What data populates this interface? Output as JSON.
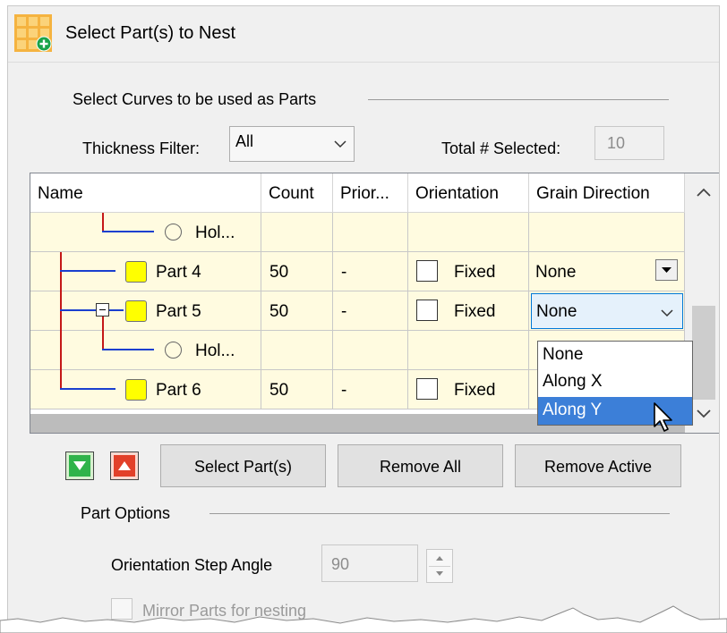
{
  "title": "Select Part(s) to Nest",
  "app_icon": "nest-grid-add-icon",
  "curves_section": {
    "label": "Select Curves to be used as Parts",
    "thickness_label": "Thickness Filter:",
    "thickness_value": "All",
    "total_label": "Total # Selected:",
    "total_value": "10"
  },
  "table": {
    "columns": [
      "Name",
      "Count",
      "Prior...",
      "Orientation",
      "Grain Direction"
    ],
    "rows": [
      {
        "name": "Hol...",
        "kind": "hole",
        "count": "",
        "priority": "",
        "orientation": "",
        "grain": ""
      },
      {
        "name": "Part 4",
        "kind": "part",
        "count": "50",
        "priority": "-",
        "orientation": "Fixed",
        "grain": "None"
      },
      {
        "name": "Part 5",
        "kind": "part",
        "count": "50",
        "priority": "-",
        "orientation": "Fixed",
        "grain": "None"
      },
      {
        "name": "Hol...",
        "kind": "hole",
        "count": "",
        "priority": "",
        "orientation": "",
        "grain": ""
      },
      {
        "name": "Part 6",
        "kind": "part",
        "count": "50",
        "priority": "-",
        "orientation": "Fixed",
        "grain": ""
      }
    ]
  },
  "grain_dropdown": {
    "options": [
      "None",
      "Along X",
      "Along Y"
    ],
    "highlighted": "Along Y",
    "highlight_color": "#3c7fd8"
  },
  "buttons": {
    "move_down_icon": "green-down-arrow-icon",
    "move_up_icon": "red-up-arrow-icon",
    "select_parts": "Select Part(s)",
    "remove_all": "Remove All",
    "remove_active": "Remove Active"
  },
  "part_options": {
    "label": "Part Options",
    "step_angle_label": "Orientation Step Angle",
    "step_angle_value": "90",
    "mirror_label": "Mirror Parts for nesting"
  }
}
